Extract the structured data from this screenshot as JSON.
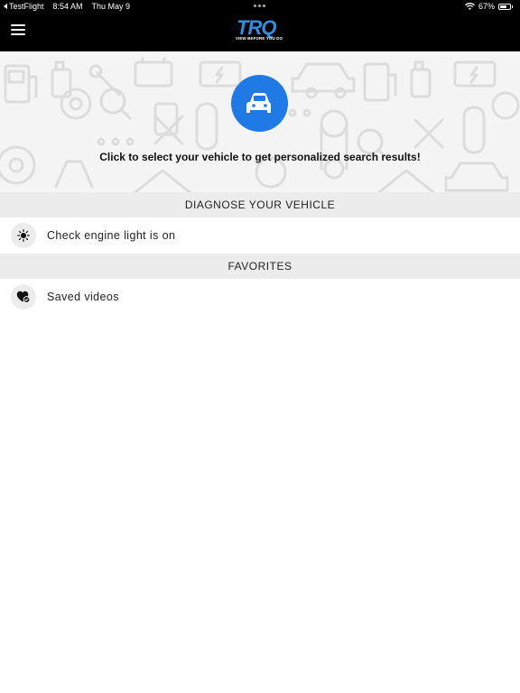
{
  "status_bar": {
    "back_app": "TestFlight",
    "time": "8:54 AM",
    "date": "Thu May 9",
    "battery": "67%",
    "battery_level": 0.67,
    "icons": [
      "wifi-icon",
      "battery-icon"
    ]
  },
  "nav": {
    "menu_icon": "hamburger-icon",
    "logo_text": "TRQ",
    "logo_tagline": "VIEW BEFORE YOU DO"
  },
  "hero": {
    "icon": "car-icon",
    "caption": "Click to select your vehicle to get personalized search results!"
  },
  "sections": [
    {
      "title": "DIAGNOSE YOUR VEHICLE",
      "items": [
        {
          "label": "Check engine light is on",
          "icon": "engine-light-icon"
        }
      ]
    },
    {
      "title": "FAVORITES",
      "items": [
        {
          "label": "Saved videos",
          "icon": "heart-check-icon"
        }
      ]
    }
  ],
  "colors": {
    "accent": "#1f7ae6",
    "brand": "#2d8fe0",
    "bar_background": "#000000",
    "section_background": "#ececec"
  }
}
